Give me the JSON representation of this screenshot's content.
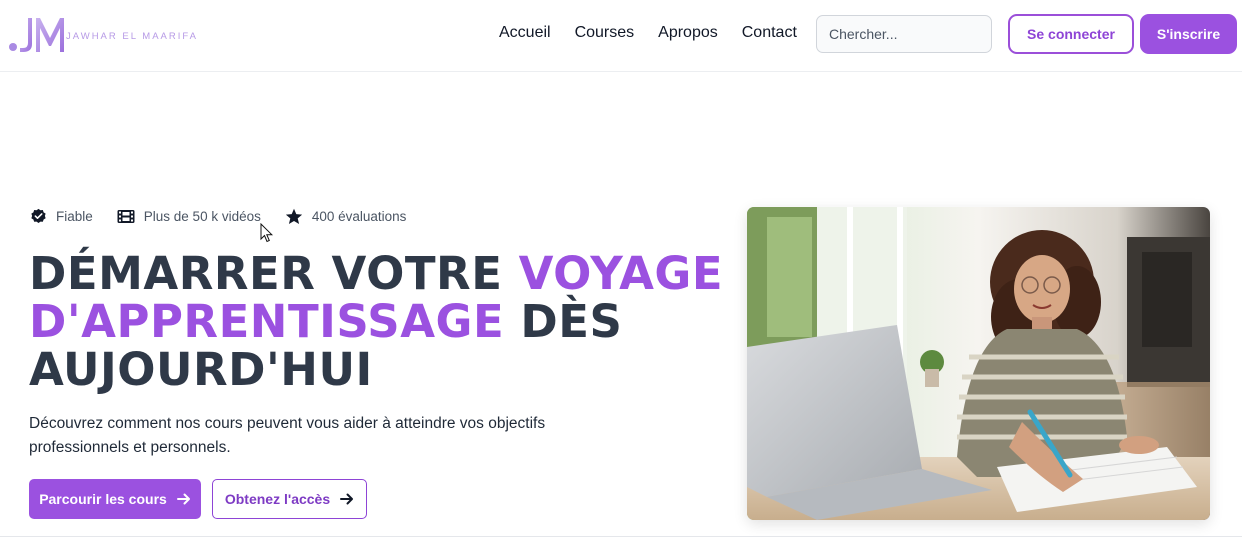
{
  "brand": {
    "logo_mark": "JM",
    "name": "JAWHAR EL MAARIFA"
  },
  "nav": {
    "items": [
      "Accueil",
      "Courses",
      "Apropos",
      "Contact"
    ]
  },
  "search": {
    "placeholder": "Chercher..."
  },
  "auth": {
    "login_label": "Se connecter",
    "signup_label": "S'inscrire"
  },
  "badges": {
    "trusted": "Fiable",
    "videos": "Plus de 50 k vidéos",
    "reviews": "400 évaluations"
  },
  "hero": {
    "title_part1": "DÉMARRER VOTRE ",
    "title_accent1": "VOYAGE",
    "title_accent2": "D'APPRENTISSAGE",
    "title_part2": " DÈS",
    "title_part3": "AUJOURD'HUI",
    "description": "Découvrez comment nos cours peuvent vous aider à atteindre vos objectifs professionnels et personnels.",
    "primary_cta": "Parcourir les cours",
    "secondary_cta": "Obtenez l'accès"
  },
  "colors": {
    "accent": "#9b51e0",
    "heading": "#2f3948"
  },
  "icons": {
    "trusted": "check-badge-icon",
    "videos": "film-icon",
    "reviews": "star-icon",
    "cta": "arrow-right-icon"
  }
}
